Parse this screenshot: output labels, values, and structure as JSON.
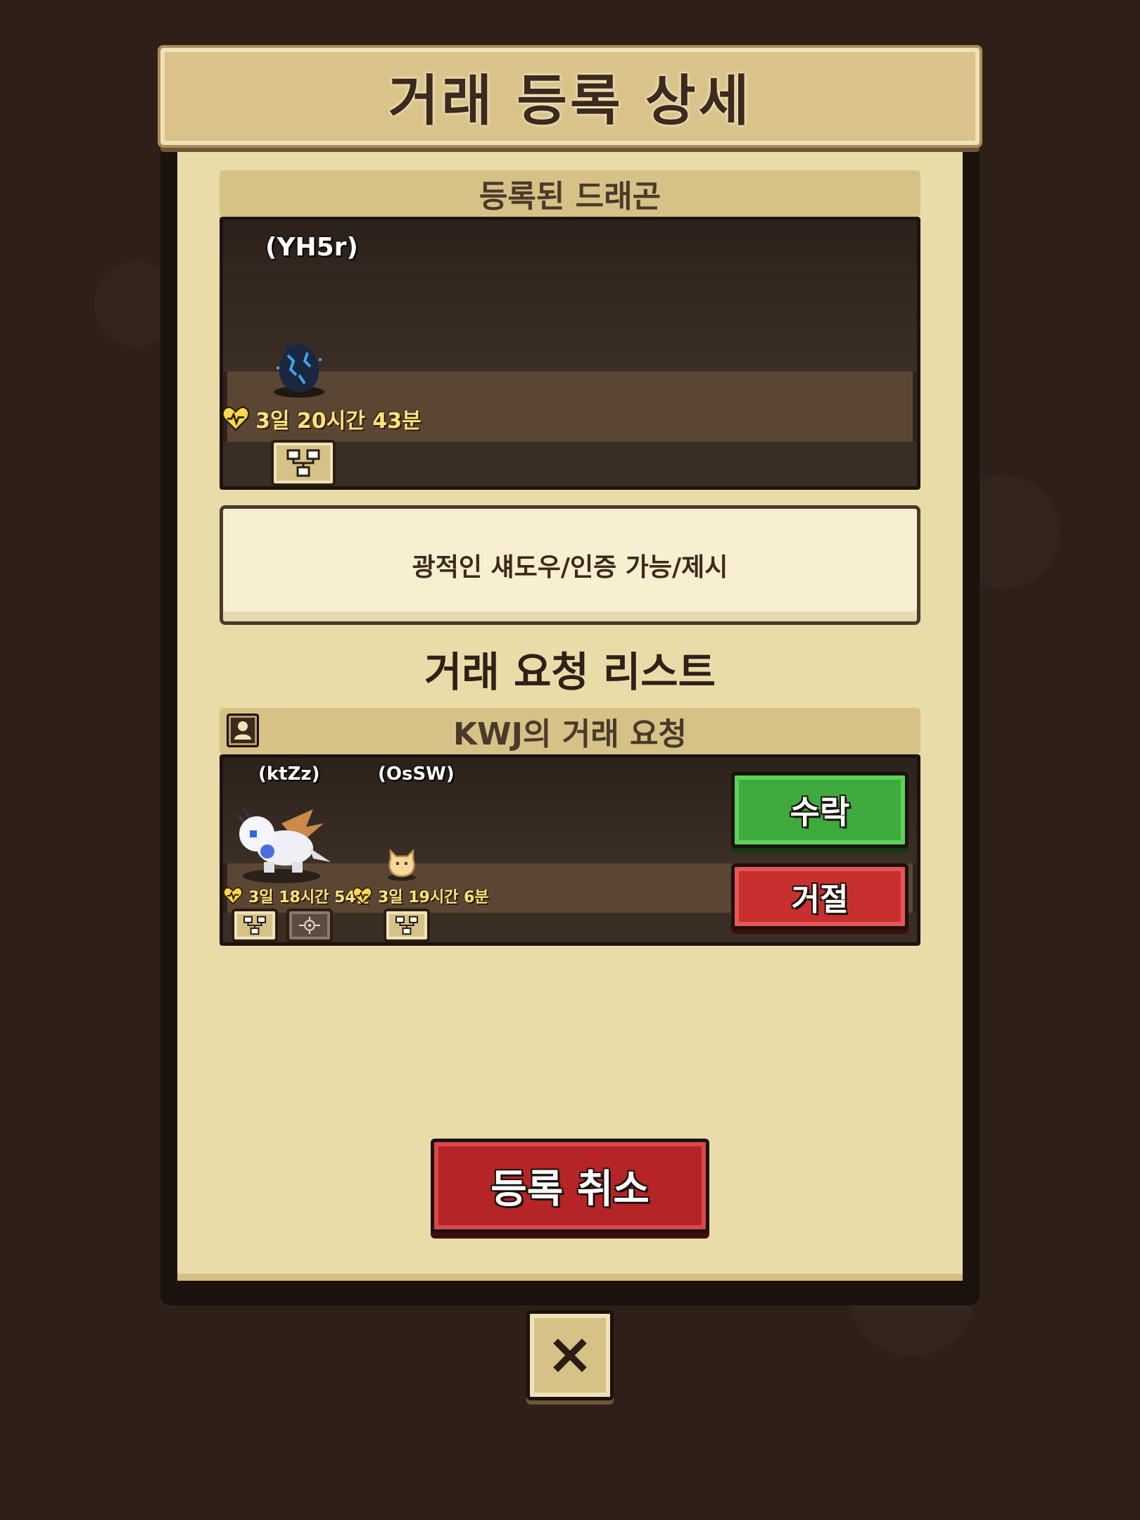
{
  "title": "거래 등록 상세",
  "registered": {
    "header": "등록된 드래곤",
    "dragon": {
      "name": "(YH5r)",
      "timer": "3일 20시간 43분"
    },
    "description": "광적인 섀도우/인증 가능/제시"
  },
  "request_list": {
    "title": "거래 요청 리스트",
    "requests": [
      {
        "header": "KWJ의 거래 요청",
        "dragons": [
          {
            "name": "(ktZz)",
            "timer": "3일 18시간 54분"
          },
          {
            "name": "(OsSW)",
            "timer": "3일 19시간 6분"
          }
        ],
        "accept_label": "수락",
        "reject_label": "거절"
      }
    ]
  },
  "cancel_label": "등록 취소",
  "colors": {
    "accept": "#3faa3e",
    "reject": "#c8302f",
    "panel": "#eadca8",
    "timer": "#ffe37a"
  },
  "icons": [
    "heart-pulse-icon",
    "lineage-tree-icon",
    "target-icon",
    "user-icon",
    "close-icon"
  ]
}
